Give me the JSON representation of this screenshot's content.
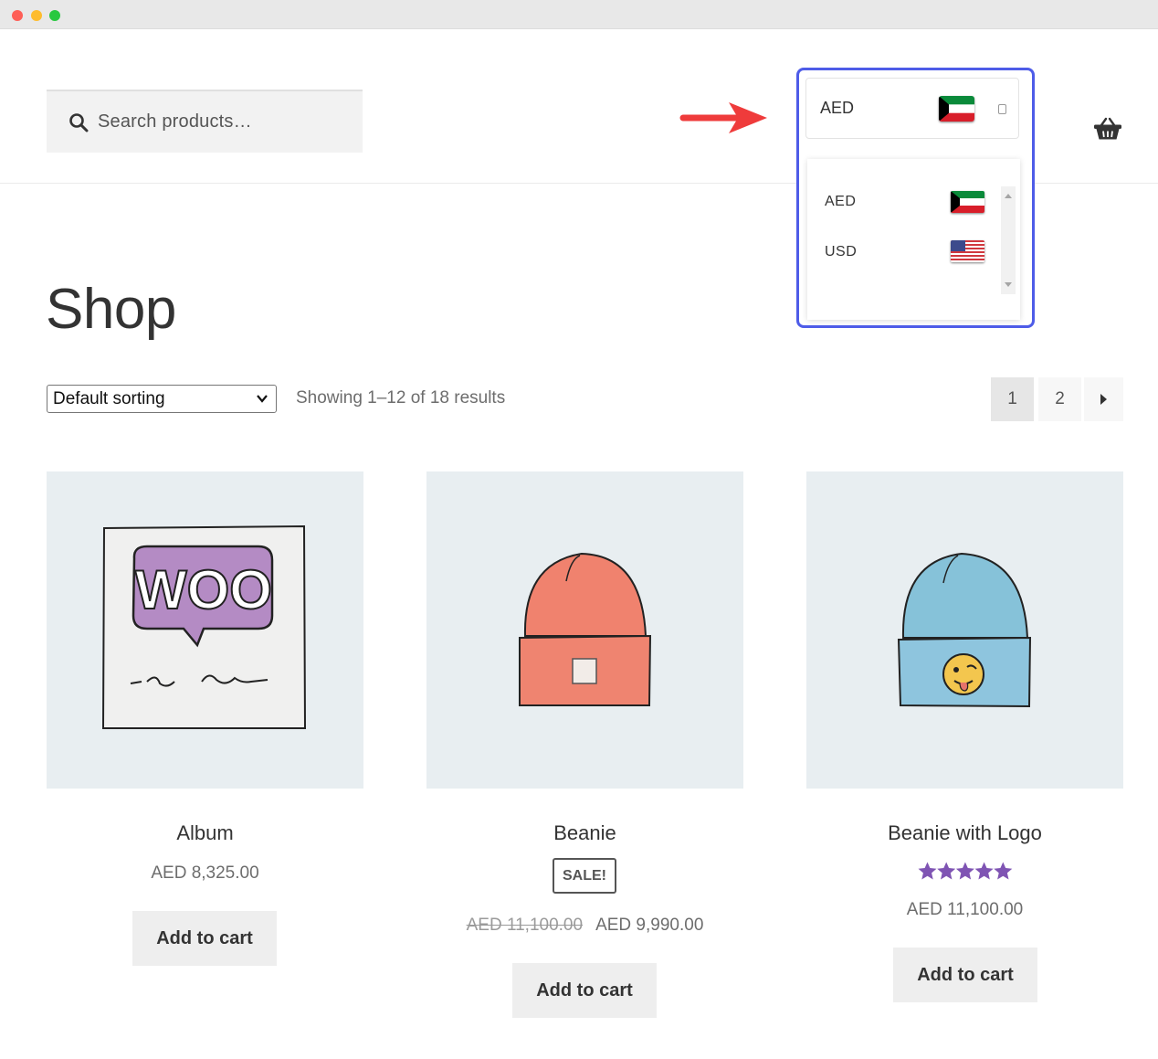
{
  "window": {
    "controls": [
      "close",
      "minimize",
      "maximize"
    ]
  },
  "header": {
    "search_placeholder": "Search products…",
    "cart_icon": "basket-icon"
  },
  "currency_switcher": {
    "selected": {
      "code": "AED",
      "flag": "kuwait-flag"
    },
    "options": [
      {
        "code": "AED",
        "flag": "kuwait-flag"
      },
      {
        "code": "USD",
        "flag": "us-flag"
      }
    ],
    "highlight_color": "#4e5ce8",
    "arrow_color": "#ef3b3b"
  },
  "shop": {
    "title": "Shop",
    "sorting": "Default sorting",
    "results": "Showing 1–12 of 18 results",
    "pagination": {
      "pages": [
        "1",
        "2"
      ],
      "current": "1",
      "next_icon": "next-arrow-icon"
    }
  },
  "products": [
    {
      "title": "Album",
      "price": "AED 8,325.00",
      "button": "Add to cart"
    },
    {
      "title": "Beanie",
      "sale_badge": "SALE!",
      "old_price": "AED 11,100.00",
      "price": "AED 9,990.00",
      "button": "Add to cart"
    },
    {
      "title": "Beanie with Logo",
      "rating": 5,
      "rating_color": "#7f54b3",
      "price": "AED 11,100.00",
      "button": "Add to cart"
    }
  ]
}
